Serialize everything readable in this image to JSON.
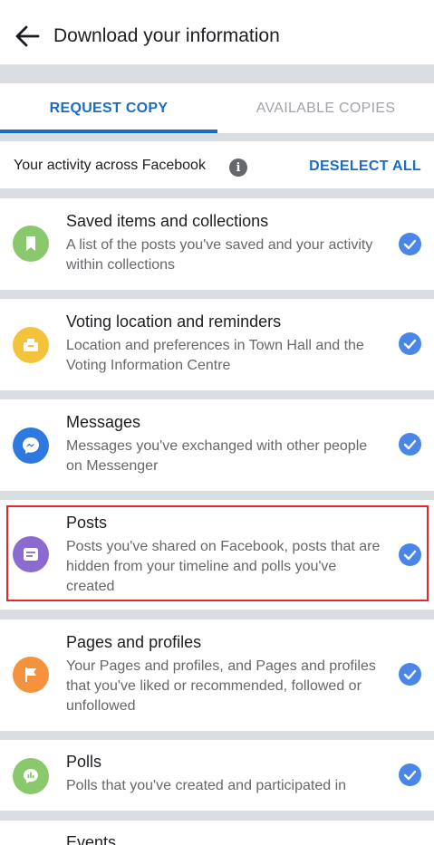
{
  "header": {
    "title": "Download your information"
  },
  "tabs": [
    {
      "label": "REQUEST COPY"
    },
    {
      "label": "AVAILABLE COPIES"
    }
  ],
  "section": {
    "title": "Your activity across Facebook",
    "deselect_label": "DESELECT ALL"
  },
  "items": [
    {
      "title": "Saved items and collections",
      "description": "A list of the posts you've saved and your activity within collections",
      "icon": "bookmark-icon",
      "color": "#8ac96b"
    },
    {
      "title": "Voting location and reminders",
      "description": "Location and preferences in Town Hall and the Voting Information Centre",
      "icon": "ballot-box-icon",
      "color": "#f5c33b"
    },
    {
      "title": "Messages",
      "description": "Messages you've exchanged with other people on Messenger",
      "icon": "messenger-icon",
      "color": "#2d79e0"
    },
    {
      "title": "Posts",
      "description": "Posts you've shared on Facebook, posts that are hidden from your timeline and polls you've created",
      "icon": "post-icon",
      "color": "#8b6bcf"
    },
    {
      "title": "Pages and profiles",
      "description": "Your Pages and profiles, and Pages and profiles that you've liked or recommended, followed or unfollowed",
      "icon": "flag-icon",
      "color": "#f5923e"
    },
    {
      "title": "Polls",
      "description": "Polls that you've created and participated in",
      "icon": "poll-icon",
      "color": "#8ac96b"
    },
    {
      "title": "Events",
      "description": "",
      "icon": "event-icon",
      "color": "#f35369"
    }
  ],
  "colors": {
    "accent": "#1b6dc1",
    "check": "#4a86e8",
    "highlight": "#e0282e"
  }
}
